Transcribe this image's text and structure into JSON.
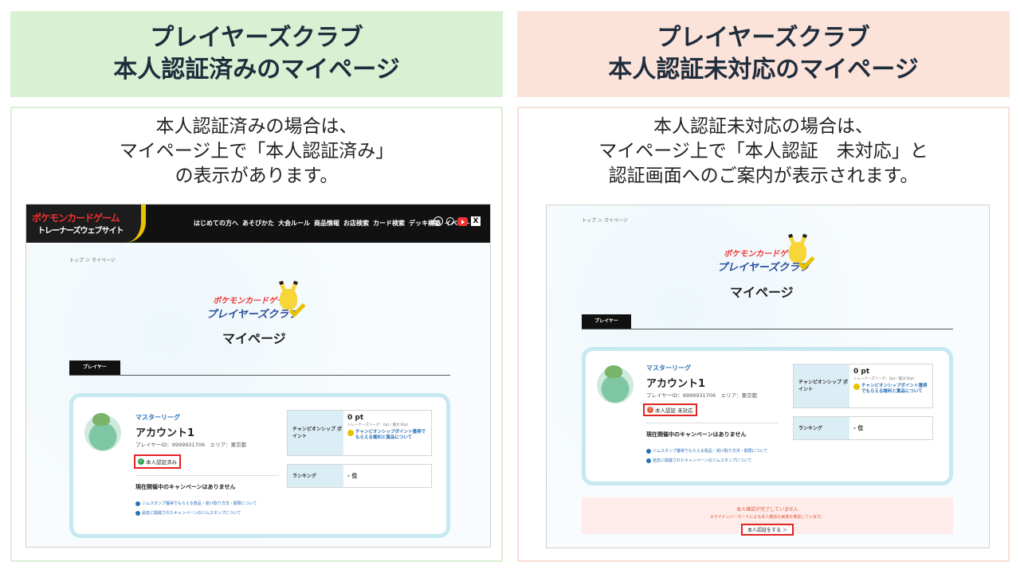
{
  "left": {
    "header": {
      "line1": "プレイヤーズクラブ",
      "line2": "本人認証済みのマイページ"
    },
    "desc": {
      "line1": "本人認証済みの場合は、",
      "line2": "マイページ上で「本人認証済み」",
      "line3": "の表示があります。"
    }
  },
  "right": {
    "header": {
      "line1": "プレイヤーズクラブ",
      "line2": "本人認証未対応のマイページ"
    },
    "desc": {
      "line1": "本人認証未対応の場合は、",
      "line2": "マイページ上で「本人認証　未対応」と",
      "line3": "認証画面へのご案内が表示されます。"
    }
  },
  "site": {
    "logo_top": "ポケモンカードゲーム",
    "logo_bottom": "トレーナーズウェブサイト",
    "nav": [
      "はじめての方へ",
      "あそびかた",
      "大会ルール",
      "商品情報",
      "お店検索",
      "カード検索",
      "デッキ構築",
      "イベント"
    ],
    "breadcrumb": "トップ ＞ マイページ",
    "club_logo_top": "ポケモンカードゲーム",
    "club_logo_bottom": "プレイヤーズクラブ",
    "page_title": "マイページ",
    "tab": "プレイヤー",
    "league": "マスターリーグ",
    "account": "アカウント1",
    "player_id": "プレイヤーID：9999931706　エリア：東京都",
    "verified_label": "本人認証済み",
    "unverified_label": "本人認証 未対応",
    "campaign": "現在開催中のキャンペーンはありません",
    "link1": "ジムスタンプ獲得でもらえる景品・受け取り方法・期限について",
    "link2": "過去に開催されたキャンペーンのジムスタンプについて",
    "champ_key": "チャンピオンシップ ポイント",
    "champ_value": "0 pt",
    "champ_sub": "トレーナーズリーグ：0pt／最大30pt",
    "champ_link": "チャンピオンシップポイント獲得でもらえる権利と賞品について",
    "rank_key": "ランキング",
    "rank_value": "- 位",
    "notice_line1": "本人確認が完了していません",
    "notice_line2": "※マイナンバーカードによる本人確認の実施を推奨しています。",
    "verify_button": "本人認証をする ＞"
  }
}
